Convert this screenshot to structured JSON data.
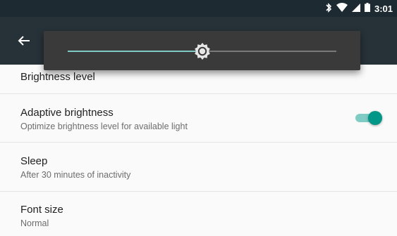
{
  "status_bar": {
    "time": "3:01",
    "icons": [
      "bluetooth-icon",
      "wifi-icon",
      "signal-icon",
      "battery-icon"
    ]
  },
  "app_bar": {
    "back_icon": "arrow-back-icon"
  },
  "brightness": {
    "level_fraction": 0.5
  },
  "preferences": [
    {
      "title": "Brightness level",
      "summary": ""
    },
    {
      "title": "Adaptive brightness",
      "summary": "Optimize brightness level for available light",
      "toggle_on": true
    },
    {
      "title": "Sleep",
      "summary": "After 30 minutes of inactivity"
    },
    {
      "title": "Font size",
      "summary": "Normal"
    }
  ],
  "colors": {
    "accent": "#009688",
    "accent_light": "#80cbc4",
    "app_bar": "#263238",
    "status_bar": "#1e2a31"
  }
}
